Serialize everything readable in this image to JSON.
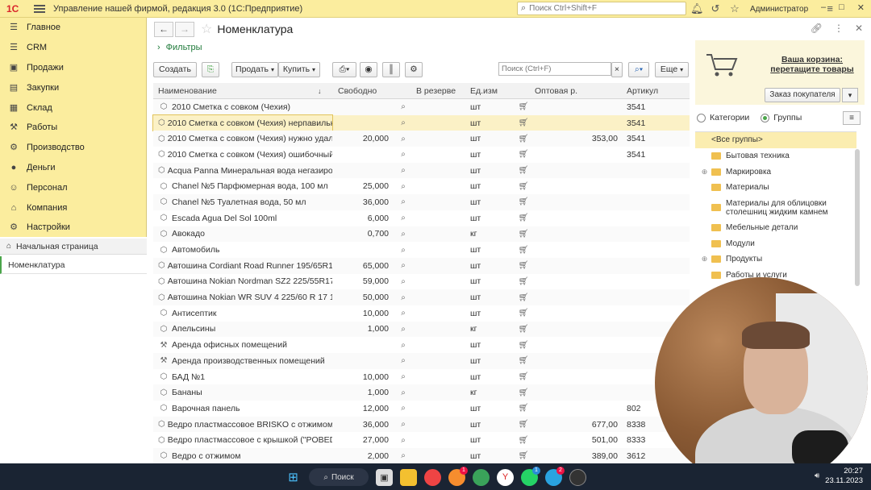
{
  "app": {
    "logo": "1С",
    "title": "Управление нашей фирмой, редакция 3.0  (1С:Предприятие)",
    "search_placeholder": "Поиск Ctrl+Shift+F",
    "user": "Администратор"
  },
  "sidebar": {
    "items": [
      {
        "label": "Главное",
        "icon": "menu-icon"
      },
      {
        "label": "CRM",
        "icon": "crm-icon"
      },
      {
        "label": "Продажи",
        "icon": "sales-icon"
      },
      {
        "label": "Закупки",
        "icon": "purchases-icon"
      },
      {
        "label": "Склад",
        "icon": "warehouse-icon"
      },
      {
        "label": "Работы",
        "icon": "works-icon"
      },
      {
        "label": "Производство",
        "icon": "production-icon"
      },
      {
        "label": "Деньги",
        "icon": "money-icon"
      },
      {
        "label": "Персонал",
        "icon": "personnel-icon"
      },
      {
        "label": "Компания",
        "icon": "company-icon"
      },
      {
        "label": "Настройки",
        "icon": "settings-icon"
      }
    ],
    "home_link": "Начальная страница",
    "open_item": "Номенклатура"
  },
  "form": {
    "title": "Номенклатура",
    "filters_label": "Фильтры",
    "toolbar": {
      "create": "Создать",
      "sell": "Продать",
      "buy": "Купить",
      "search_placeholder": "Поиск (Ctrl+F)",
      "clear": "×",
      "more": "Еще"
    },
    "columns": [
      "Наименование",
      "Свободно",
      "В резерве",
      "Ед.изм",
      "Оптовая р.",
      "Артикул"
    ],
    "rows": [
      {
        "name": "2010 Сметка с совком (Чехия)",
        "free": "",
        "unit": "шт",
        "price": "",
        "article": "3541",
        "icon": "cube"
      },
      {
        "name": "2010 Сметка с совком (Чехия) нерпавильный",
        "free": "",
        "unit": "шт",
        "price": "",
        "article": "3541",
        "icon": "cube"
      },
      {
        "name": "2010 Сметка с совком (Чехия) нужно удалить",
        "free": "20,000",
        "unit": "шт",
        "price": "353,00",
        "article": "3541",
        "icon": "cube"
      },
      {
        "name": "2010 Сметка с совком (Чехия) ошибочный",
        "free": "",
        "unit": "шт",
        "price": "",
        "article": "3541",
        "icon": "cube"
      },
      {
        "name": "Acqua Panna Минеральная вода негазиров...",
        "free": "",
        "unit": "шт",
        "price": "",
        "article": "",
        "icon": "cube"
      },
      {
        "name": "Chanel №5 Парфюмерная вода, 100 мл",
        "free": "25,000",
        "unit": "шт",
        "price": "",
        "article": "",
        "icon": "cube"
      },
      {
        "name": "Chanel №5 Туалетная вода, 50 мл",
        "free": "36,000",
        "unit": "шт",
        "price": "",
        "article": "",
        "icon": "cube"
      },
      {
        "name": "Escada Agua Del Sol 100ml",
        "free": "6,000",
        "unit": "шт",
        "price": "",
        "article": "",
        "icon": "cube"
      },
      {
        "name": "Авокадо",
        "free": "0,700",
        "unit": "кг",
        "price": "",
        "article": "",
        "icon": "cube"
      },
      {
        "name": "Автомобиль",
        "free": "",
        "unit": "шт",
        "price": "",
        "article": "",
        "icon": "cube"
      },
      {
        "name": "Автошина Cordiant Road Runner 195/65R15 ...",
        "free": "65,000",
        "unit": "шт",
        "price": "",
        "article": "",
        "icon": "cube"
      },
      {
        "name": "Автошина Nokian Nordman SZ2 225/55R17 ...",
        "free": "59,000",
        "unit": "шт",
        "price": "",
        "article": "",
        "icon": "cube"
      },
      {
        "name": "Автошина Nokian WR SUV 4 225/60 R 17 1...",
        "free": "50,000",
        "unit": "шт",
        "price": "",
        "article": "",
        "icon": "cube"
      },
      {
        "name": "Антисептик",
        "free": "10,000",
        "unit": "шт",
        "price": "",
        "article": "",
        "icon": "cube"
      },
      {
        "name": "Апельсины",
        "free": "1,000",
        "unit": "кг",
        "price": "",
        "article": "",
        "icon": "cube"
      },
      {
        "name": "Аренда офисных помещений",
        "free": "",
        "unit": "шт",
        "price": "",
        "article": "",
        "icon": "service"
      },
      {
        "name": "Аренда производственных помещений",
        "free": "",
        "unit": "шт",
        "price": "",
        "article": "",
        "icon": "service"
      },
      {
        "name": "БАД №1",
        "free": "10,000",
        "unit": "шт",
        "price": "",
        "article": "",
        "icon": "cube"
      },
      {
        "name": "Бананы",
        "free": "1,000",
        "unit": "кг",
        "price": "",
        "article": "",
        "icon": "cube"
      },
      {
        "name": "Варочная панель",
        "free": "12,000",
        "unit": "шт",
        "price": "",
        "article": "802",
        "icon": "cube"
      },
      {
        "name": "Ведро пластмассовое BRISKO с отжимом (...",
        "free": "36,000",
        "unit": "шт",
        "price": "677,00",
        "article": "8338",
        "icon": "cube"
      },
      {
        "name": "Ведро пластмассовое с крышкой (\"POBEDA\")",
        "free": "27,000",
        "unit": "шт",
        "price": "501,00",
        "article": "8333",
        "icon": "cube"
      },
      {
        "name": "Ведро с отжимом",
        "free": "2,000",
        "unit": "шт",
        "price": "389,00",
        "article": "3612",
        "icon": "cube"
      }
    ]
  },
  "cart": {
    "title_line1": "Ваша корзина:",
    "title_line2": "перетащите товары",
    "order_button": "Заказ покупателя"
  },
  "groups": {
    "radio_categories": "Категории",
    "radio_groups": "Группы",
    "nodes": [
      {
        "label": "<Все группы>",
        "expandable": false
      },
      {
        "label": "Бытовая техника",
        "expandable": false
      },
      {
        "label": "Маркировка",
        "expandable": true
      },
      {
        "label": "Материалы",
        "expandable": false
      },
      {
        "label": "Материалы для облицовки столешниц жидким камнем",
        "expandable": false
      },
      {
        "label": "Мебельные детали",
        "expandable": false
      },
      {
        "label": "Модули",
        "expandable": false
      },
      {
        "label": "Продукты",
        "expandable": true
      },
      {
        "label": "Работы и услуги",
        "expandable": false
      }
    ]
  },
  "taskbar": {
    "search": "Поиск",
    "time": "20:27",
    "date": "23.11.2023",
    "badges": [
      "1",
      "1",
      "2"
    ]
  },
  "colors": {
    "accent_yellow": "#fbed9e",
    "selection": "#fbf1c6",
    "green_link": "#1f7a3a"
  }
}
